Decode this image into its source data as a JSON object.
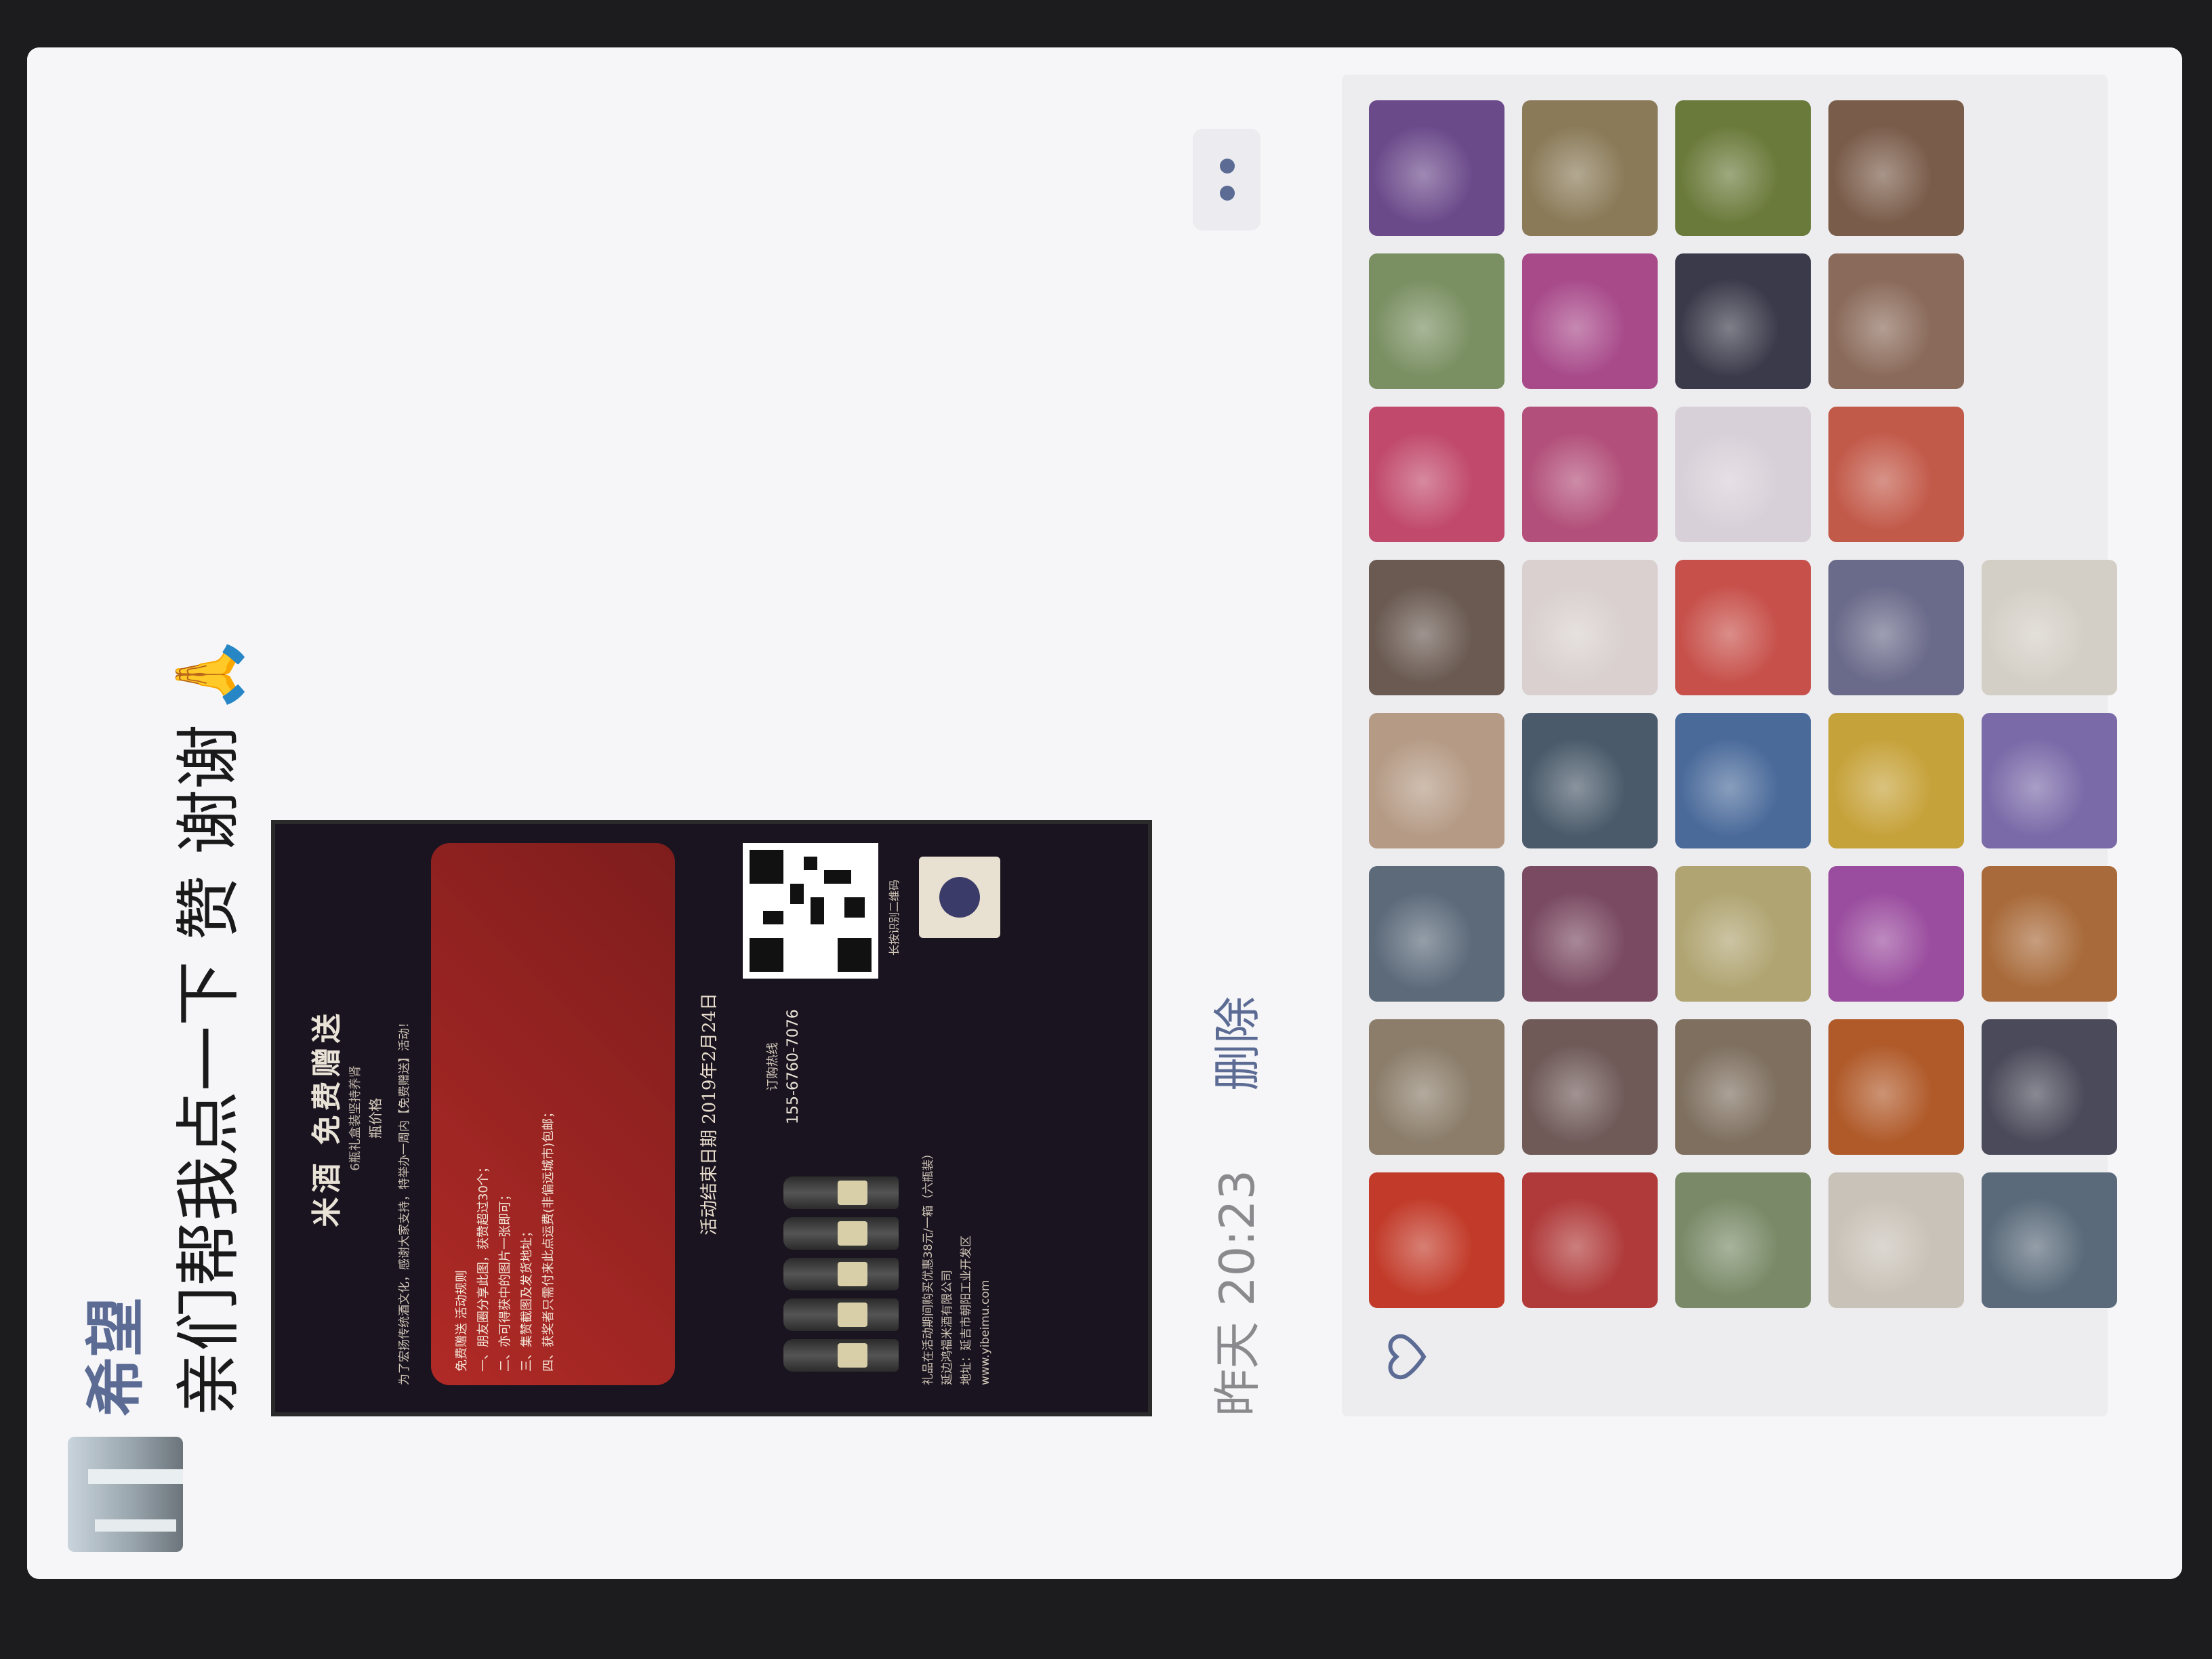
{
  "post": {
    "author": "希望",
    "text": "亲们帮我点一下 赞 谢谢",
    "emoji": "🙏",
    "time": "昨天 20:23",
    "delete_label": "删除"
  },
  "poster": {
    "title": "米酒 免费赠送",
    "subtitle": "6瓶礼盒装坚持养肾",
    "note": "瓶价格",
    "intro": "为了宏扬传统酒文化，感谢大家支持，特举办一周内【免费赠送】活动！",
    "rules": [
      "免费赠送 活动规则",
      "一、朋友圈分享此图，获赞超过30个；",
      "二、亦可得获中的图片一张即可；",
      "三、集赞截图及发货地址；",
      "四、获奖者只需付来此点运费(非偏远城市)包邮；"
    ],
    "deadline": "活动结束日期 2019年2月24日",
    "hotline_label": "订购热线",
    "hotline": "155-6760-7076",
    "qr_caption": "长按识别二维码",
    "footer": [
      "礼品在活动期间购买优惠38元/一箱（六瓶装）",
      "延边鸿福米酒有限公司",
      "地址：延吉市朝阳工业开发区",
      "www.yibeimu.com"
    ]
  },
  "likes": {
    "avatar_colors": [
      "#c23b2a",
      "#8b7d6a",
      "#5c6a7a",
      "#b59b86",
      "#6a5a52",
      "#c14a6c",
      "#7a8f62",
      "#6b4a8a",
      "#b03a3a",
      "#6f5a58",
      "#7a4a62",
      "#4a5a6a",
      "#d9d0cf",
      "#b24f7a",
      "#a84a8a",
      "#8a7a58",
      "#7a8a68",
      "#7e6f5f",
      "#b0a472",
      "#4a6a9a",
      "#c7504a",
      "#d8d0d8",
      "#3a3a4a",
      "#6a7a3a",
      "#c9c2b8",
      "#b05a2a",
      "#9a4c9e",
      "#c6a23a",
      "#6a6a8a",
      "#c25a4a",
      "#8a6a5a",
      "#7a5c4a",
      "#5a6a7a",
      "#4a4a5a",
      "#a86a3a",
      "#7a6aa8",
      "#d4cfc6"
    ]
  }
}
